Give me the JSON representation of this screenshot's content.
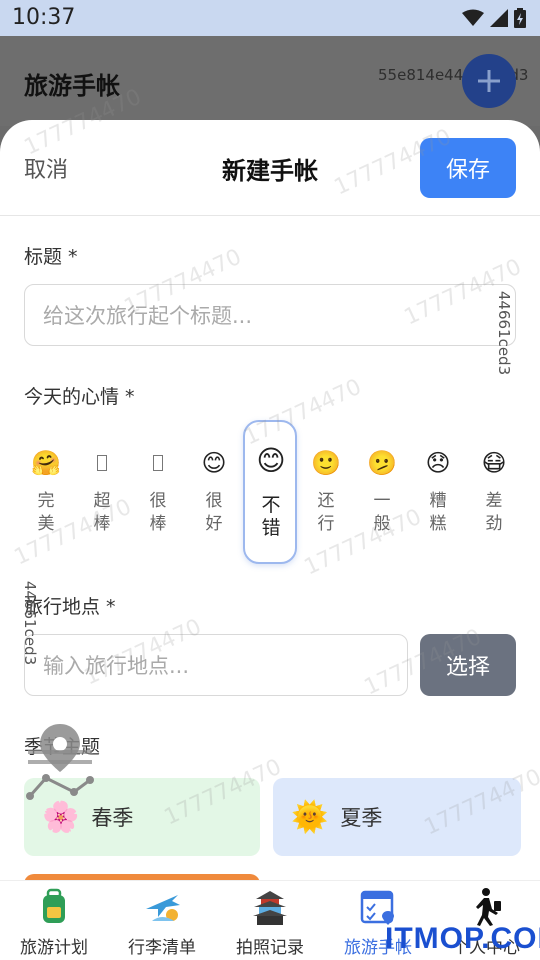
{
  "status_bar": {
    "time": "10:37",
    "icons": [
      "wifi-icon",
      "signal-icon",
      "battery-icon"
    ]
  },
  "app_bar": {
    "title": "旅游手帐",
    "id_text": "55e814e44661ced3",
    "fab_icon": "plus-icon"
  },
  "sheet": {
    "cancel_label": "取消",
    "title": "新建手帐",
    "save_label": "保存",
    "title_field": {
      "label": "标题 *",
      "placeholder": "给这次旅行起个标题..."
    },
    "mood_field": {
      "label": "今天的心情 *",
      "moods": [
        {
          "emoji": "🤗",
          "line1": "完",
          "line2": "美"
        },
        {
          "emoji": "",
          "line1": "超",
          "line2": "棒"
        },
        {
          "emoji": "",
          "line1": "很",
          "line2": "棒"
        },
        {
          "emoji": "😊",
          "line1": "很",
          "line2": "好"
        },
        {
          "emoji": "😊",
          "line1": "不",
          "line2": "错",
          "selected": true
        },
        {
          "emoji": "🙂",
          "line1": "还",
          "line2": "行"
        },
        {
          "emoji": "🫤",
          "line1": "一",
          "line2": "般"
        },
        {
          "emoji": "😞",
          "line1": "糟",
          "line2": "糕"
        },
        {
          "emoji": "😷",
          "line1": "差",
          "line2": "劲"
        }
      ]
    },
    "location_field": {
      "label": "旅行地点 *",
      "placeholder": "输入旅行地点...",
      "select_label": "选择"
    },
    "season_field": {
      "label": "季节主题",
      "seasons": [
        {
          "name": "春季",
          "icon": "🌸",
          "color": "#e3f7e6"
        },
        {
          "name": "夏季",
          "icon": "🌞",
          "color": "#dde8fb"
        }
      ]
    }
  },
  "watermark": {
    "text": "177774470",
    "side_text": "44661ced3"
  },
  "tab_bar": {
    "tabs": [
      {
        "label": "旅游计划",
        "icon": "backpack-icon"
      },
      {
        "label": "行李清单",
        "icon": "airplane-icon"
      },
      {
        "label": "拍照记录",
        "icon": "pagoda-icon"
      },
      {
        "label": "旅游手帐",
        "icon": "map-checklist-icon",
        "active": true
      },
      {
        "label": "个人中心",
        "icon": "walking-person-icon"
      }
    ]
  },
  "brand": "ITMOP.COM",
  "colors": {
    "primary": "#3d83f6",
    "select_button": "#6b7280",
    "active_tab": "#3b6fe0"
  }
}
